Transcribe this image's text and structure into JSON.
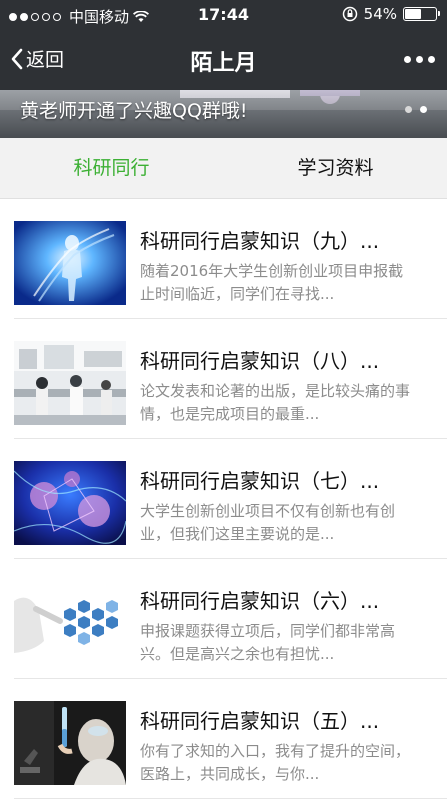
{
  "status_bar": {
    "carrier": "中国移动",
    "time": "17:44",
    "battery": "54%",
    "battery_level": 0.54,
    "signal_bars": 2
  },
  "nav": {
    "back_label": "返回",
    "title": "陌上月"
  },
  "banner": {
    "text": "黄老师开通了兴趣QQ群哦!",
    "page_count": 2,
    "active_index": 1
  },
  "tabs": [
    {
      "label": "科研同行",
      "active": true,
      "color": "#3cb034"
    },
    {
      "label": "学习资料",
      "active": false,
      "color": "#111111"
    }
  ],
  "articles": [
    {
      "title": "科研同行启蒙知识（九）...",
      "desc": "随着2016年大学生创新创业项目申报截止时间临近，同学们在寻找...",
      "image": "dna-figure-image"
    },
    {
      "title": "科研同行启蒙知识（八）...",
      "desc": "论文发表和论著的出版，是比较头痛的事情，也是完成项目的最重...",
      "image": "laboratory-image"
    },
    {
      "title": "科研同行启蒙知识（七）...",
      "desc": "大学生创新创业项目不仅有创新也有创业，但我们这里主要说的是...",
      "image": "neuron-network-image"
    },
    {
      "title": "科研同行启蒙知识（六）...",
      "desc": "申报课题获得立项后，同学们都非常高兴。但是高兴之余也有担忧...",
      "image": "medical-hexagon-image"
    },
    {
      "title": "科研同行启蒙知识（五）...",
      "desc": "你有了求知的入口，我有了提升的空间，医路上，共同成长，与你...",
      "image": "scientist-test-tube-image"
    }
  ]
}
